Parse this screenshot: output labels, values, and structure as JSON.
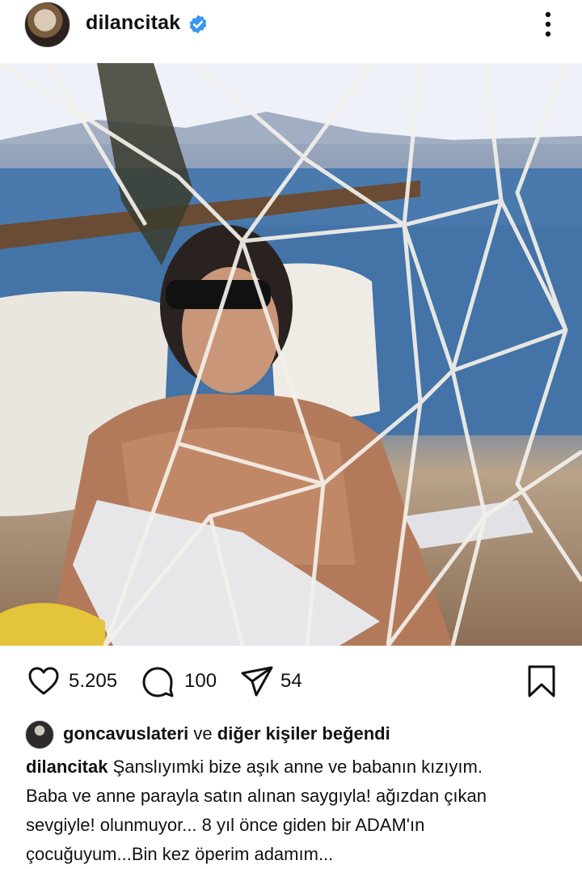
{
  "post": {
    "username": "dilancitak",
    "avatar_icon": "profile-avatar",
    "verified_icon": "verified-badge-icon",
    "more_icon": "more-vertical-icon"
  },
  "photo": {
    "description_icon": "post-photo"
  },
  "actions": {
    "likes_count": "5.205",
    "comments_count": "100",
    "shares_count": "54",
    "like_icon": "heart-icon",
    "comment_icon": "comment-icon",
    "share_icon": "send-icon",
    "save_icon": "bookmark-icon"
  },
  "liked_by": {
    "user": "goncavuslateri",
    "connector": "ve",
    "others": "diğer kişiler beğendi"
  },
  "caption": {
    "username": "dilancitak",
    "line1": "Şanslıyımki bize aşık anne ve babanın kızıyım.",
    "line2": "Baba ve anne parayla satın alınan saygıyla! ağızdan çıkan",
    "line3": "sevgiyle! olunmuyor... 8 yıl önce giden bir ADAM'ın",
    "line4": "çocuğuyum...Bin kez öperim adamım..."
  },
  "colors": {
    "verified_blue": "#3897f0",
    "text": "#111111",
    "background": "#ffffff"
  }
}
